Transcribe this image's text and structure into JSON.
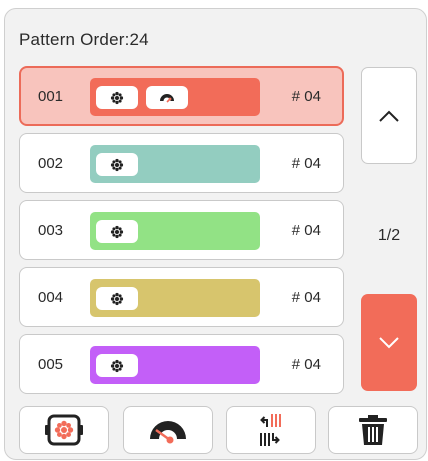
{
  "header": {
    "title": "Pattern Order:24"
  },
  "patterns": [
    {
      "number": "001",
      "code": "# 04",
      "color": "#f26c59",
      "selected": true,
      "chips": [
        "flower-icon",
        "gauge-icon"
      ]
    },
    {
      "number": "002",
      "code": "# 04",
      "color": "#93cdc0",
      "selected": false,
      "chips": [
        "flower-icon"
      ]
    },
    {
      "number": "003",
      "code": "# 04",
      "color": "#92e285",
      "selected": false,
      "chips": [
        "flower-icon"
      ]
    },
    {
      "number": "004",
      "code": "# 04",
      "color": "#d7c56d",
      "selected": false,
      "chips": [
        "flower-icon"
      ]
    },
    {
      "number": "005",
      "code": "# 04",
      "color": "#c35ff8",
      "selected": false,
      "chips": [
        "flower-icon"
      ]
    }
  ],
  "pager": {
    "indicator": "1/2"
  },
  "toolbar": {
    "buttons": [
      "pattern-frame-icon",
      "speed-gauge-icon",
      "reorder-icon",
      "trash-icon"
    ]
  },
  "colors": {
    "accent": "#f26c59",
    "selected_row_bg": "#f8c4bd",
    "selected_row_border": "#ec6b59"
  }
}
